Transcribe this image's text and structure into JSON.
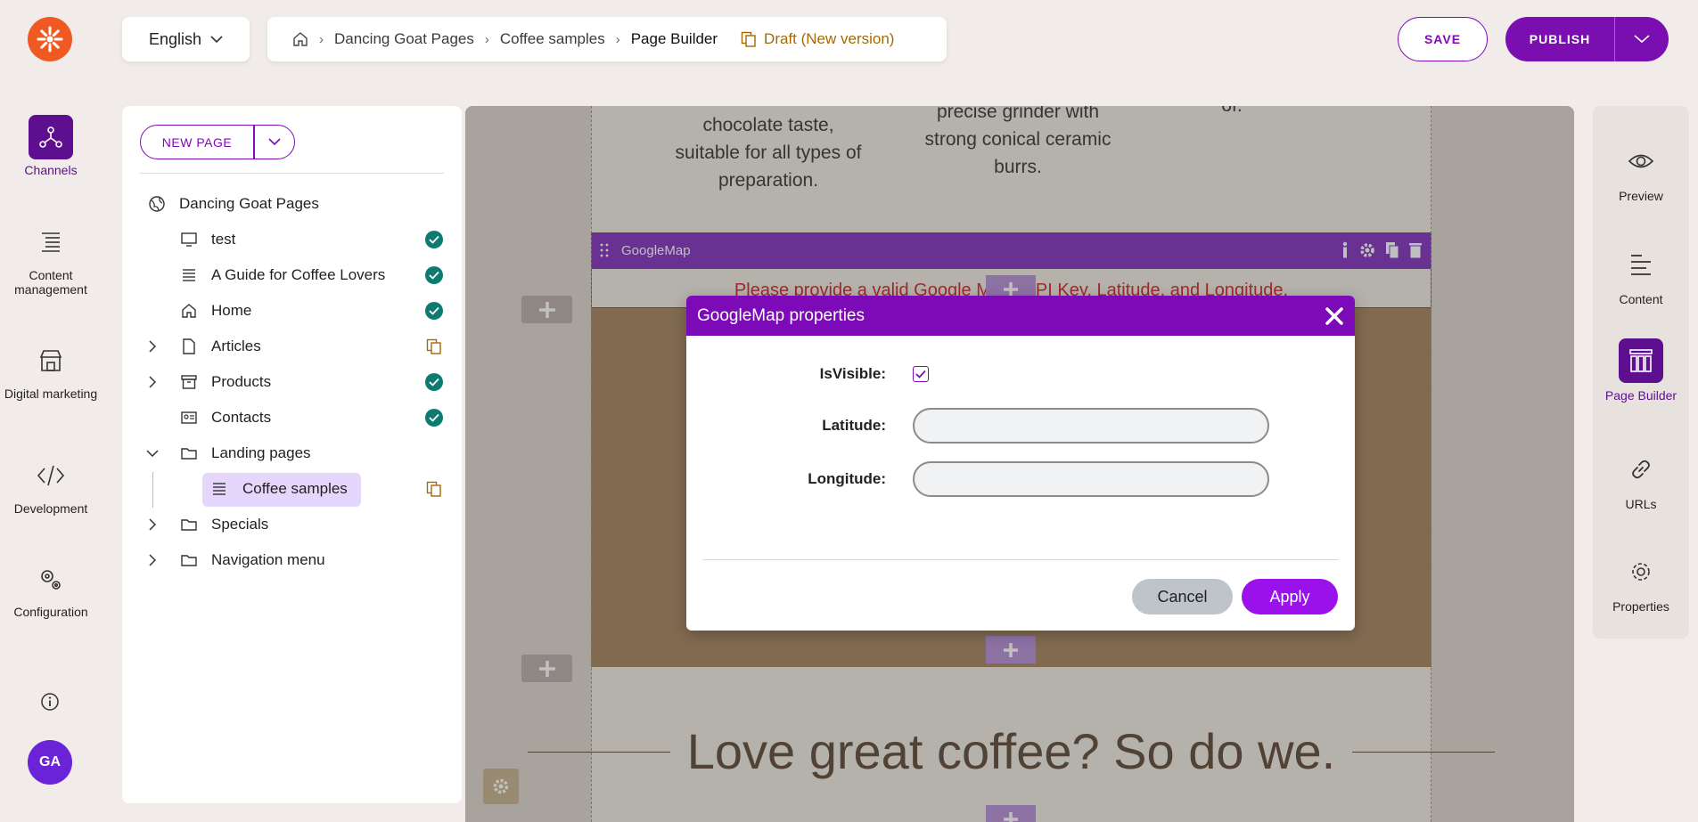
{
  "header": {
    "language": "English",
    "breadcrumbs": [
      "Dancing Goat Pages",
      "Coffee samples",
      "Page Builder"
    ],
    "draft_status": "Draft (New version)",
    "save_label": "SAVE",
    "publish_label": "PUBLISH"
  },
  "nav": {
    "channels": "Channels",
    "content_management": "Content management",
    "digital_marketing": "Digital marketing",
    "development": "Development",
    "configuration": "Configuration",
    "avatar_initials": "GA"
  },
  "tree": {
    "new_page_label": "NEW PAGE",
    "root": "Dancing Goat Pages",
    "items": [
      {
        "label": "test",
        "status": "published"
      },
      {
        "label": "A Guide for Coffee Lovers",
        "status": "published"
      },
      {
        "label": "Home",
        "status": "published"
      },
      {
        "label": "Articles",
        "status": "draft"
      },
      {
        "label": "Products",
        "status": "published"
      },
      {
        "label": "Contacts",
        "status": "published"
      },
      {
        "label": "Landing pages",
        "status": ""
      },
      {
        "label": "Coffee samples",
        "status": "draft"
      },
      {
        "label": "Specials",
        "status": ""
      },
      {
        "label": "Navigation menu",
        "status": ""
      }
    ]
  },
  "canvas": {
    "product_text_1": "chocolate taste,\nsuitable for all types of\npreparation.",
    "product_text_2": "precise grinder with\nstrong conical ceramic\nburrs.",
    "product_text_3": "of.",
    "widget_name": "GoogleMap",
    "widget_error": "Please provide a valid Google Maps API Key, Latitude, and Longitude.",
    "headline": "Love great coffee? So do we."
  },
  "modal": {
    "title": "GoogleMap properties",
    "isvisible_label": "IsVisible:",
    "isvisible_checked": true,
    "latitude_label": "Latitude:",
    "latitude_value": "",
    "longitude_label": "Longitude:",
    "longitude_value": "",
    "cancel_label": "Cancel",
    "apply_label": "Apply"
  },
  "right_panel": {
    "preview": "Preview",
    "content": "Content",
    "page_builder": "Page Builder",
    "urls": "URLs",
    "properties": "Properties"
  },
  "colors": {
    "brand_purple": "#7b0eb0",
    "accent_orange": "#f05a22",
    "published_green": "#0c7c72",
    "draft_amber": "#a26a08",
    "error_red": "#d21f26"
  }
}
